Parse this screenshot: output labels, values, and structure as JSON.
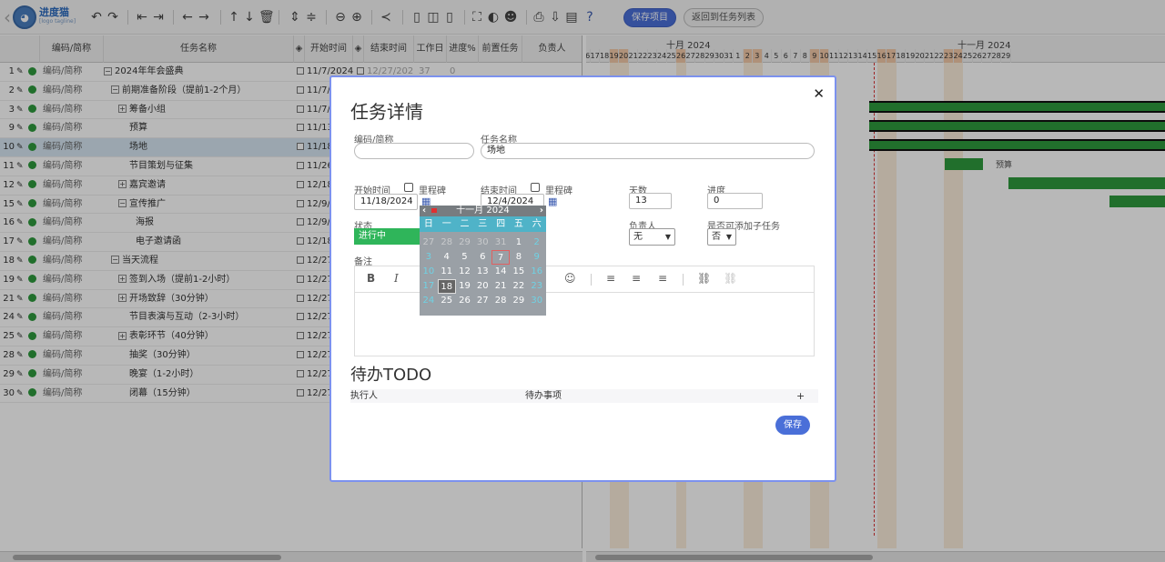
{
  "app": {
    "logo_text": "进度猫",
    "logo_sub": "[logo tagline]"
  },
  "toolbar": {
    "save_project": "保存项目",
    "back_to_list": "返回到任务列表",
    "icons": [
      "undo-icon",
      "redo-icon",
      "outdent-icon",
      "indent-icon",
      "move-left-icon",
      "move-right-icon",
      "move-up-icon",
      "move-down-icon",
      "delete-icon",
      "expand-icon",
      "collapse-icon",
      "zoom-out-icon",
      "zoom-in-icon",
      "critical-path-icon",
      "layout-left-icon",
      "layout-split-icon",
      "layout-right-icon",
      "fullscreen-icon",
      "palette-icon",
      "resources-icon",
      "print-icon",
      "export-icon",
      "excel-icon",
      "help-icon"
    ]
  },
  "grid": {
    "columns": [
      "编码/简称",
      "任务名称",
      "开始时间",
      "结束时间",
      "工作日",
      "进度%",
      "前置任务",
      "负责人"
    ],
    "rows": [
      {
        "no": "1",
        "code": "编码/简称",
        "name": "2024年年会盛典",
        "exp": "−",
        "start": "11/7/2024",
        "end": "12/27/2024",
        "days": "37",
        "prog": "0"
      },
      {
        "no": "2",
        "code": "编码/简称",
        "name": "前期准备阶段（提前1-2个月）",
        "exp": "−",
        "start": "11/7/2"
      },
      {
        "no": "3",
        "code": "编码/简称",
        "name": "筹备小组",
        "exp": "+",
        "start": "11/7/2"
      },
      {
        "no": "9",
        "code": "编码/简称",
        "name": "预算",
        "exp": "",
        "start": "11/13/"
      },
      {
        "no": "10",
        "code": "编码/简称",
        "name": "场地",
        "exp": "",
        "start": "11/18/",
        "sel": true
      },
      {
        "no": "11",
        "code": "编码/简称",
        "name": "节目策划与征集",
        "exp": "",
        "start": "11/26/"
      },
      {
        "no": "12",
        "code": "编码/简称",
        "name": "嘉宾邀请",
        "exp": "+",
        "start": "12/18/"
      },
      {
        "no": "15",
        "code": "编码/简称",
        "name": "宣传推广",
        "exp": "−",
        "start": "12/9/2"
      },
      {
        "no": "16",
        "code": "编码/简称",
        "name": "海报",
        "exp": "",
        "start": "12/9/2"
      },
      {
        "no": "17",
        "code": "编码/简称",
        "name": "电子邀请函",
        "exp": "",
        "start": "12/18/"
      },
      {
        "no": "18",
        "code": "编码/简称",
        "name": "当天流程",
        "exp": "−",
        "start": "12/27/"
      },
      {
        "no": "19",
        "code": "编码/简称",
        "name": "签到入场（提前1-2小时）",
        "exp": "+",
        "start": "12/27/"
      },
      {
        "no": "21",
        "code": "编码/简称",
        "name": "开场致辞（30分钟）",
        "exp": "+",
        "start": "12/27/"
      },
      {
        "no": "24",
        "code": "编码/简称",
        "name": "节目表演与互动（2-3小时）",
        "exp": "",
        "start": "12/27/"
      },
      {
        "no": "25",
        "code": "编码/简称",
        "name": "表彰环节（40分钟）",
        "exp": "+",
        "start": "12/27/"
      },
      {
        "no": "28",
        "code": "编码/简称",
        "name": "抽奖（30分钟）",
        "exp": "",
        "start": "12/27/"
      },
      {
        "no": "29",
        "code": "编码/简称",
        "name": "晚宴（1-2小时）",
        "exp": "",
        "start": "12/27/"
      },
      {
        "no": "30",
        "code": "编码/简称",
        "name": "闭幕（15分钟）",
        "exp": "",
        "start": "12/27/"
      }
    ]
  },
  "gantt": {
    "months": [
      {
        "label": "十月 2024"
      },
      {
        "label": "十一月 2024"
      }
    ],
    "bar_label": "预算"
  },
  "modal": {
    "title": "任务详情",
    "code_label": "编码/简称",
    "code_value": "",
    "name_label": "任务名称",
    "name_value": "场地",
    "start_label": "开始时间",
    "milestone_label": "里程碑",
    "start_value": "11/18/2024",
    "end_label": "结束时间",
    "end_value": "12/4/2024",
    "days_label": "天数",
    "days_value": "13",
    "progress_label": "进度",
    "progress_value": "0",
    "status_label": "状态",
    "status_value": "进行中",
    "owner_label": "负责人",
    "owner_value": "无",
    "subtask_label": "是否可添加子任务",
    "subtask_value": "否",
    "notes_label": "备注",
    "todo_title": "待办TODO",
    "todo_col1": "执行人",
    "todo_col2": "待办事项",
    "todo_add": "+",
    "save": "保存"
  },
  "calendar": {
    "title": "十一月 2024",
    "weekdays": [
      "日",
      "一",
      "二",
      "三",
      "四",
      "五",
      "六"
    ],
    "weeks": [
      [
        "27",
        "28",
        "29",
        "30",
        "31",
        "1",
        "2"
      ],
      [
        "3",
        "4",
        "5",
        "6",
        "7",
        "8",
        "9"
      ],
      [
        "10",
        "11",
        "12",
        "13",
        "14",
        "15",
        "16"
      ],
      [
        "17",
        "18",
        "19",
        "20",
        "21",
        "22",
        "23"
      ],
      [
        "24",
        "25",
        "26",
        "27",
        "28",
        "29",
        "30"
      ]
    ],
    "today": "7",
    "selected": "18"
  },
  "colors": {
    "accent": "#4a6fd8",
    "bar": "#2e9a3e",
    "status": "#2fb55a",
    "calendar_header": "#4fb3c8"
  }
}
